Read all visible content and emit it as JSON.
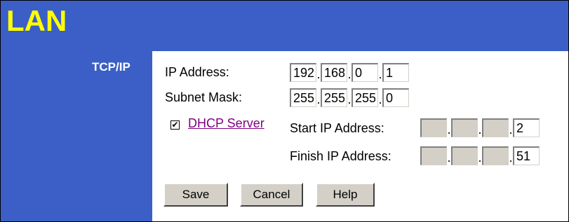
{
  "page": {
    "title": "LAN",
    "section_label": "TCP/IP"
  },
  "ip_address": {
    "label": "IP Address:",
    "octets": [
      "192",
      "168",
      "0",
      "1"
    ]
  },
  "subnet_mask": {
    "label": "Subnet Mask:",
    "octets": [
      "255",
      "255",
      "255",
      "0"
    ]
  },
  "dhcp": {
    "checked": true,
    "checkbox_glyph": "✔",
    "link_label": "DHCP Server",
    "start": {
      "label": "Start IP Address:",
      "octets": [
        "",
        "",
        "",
        "2"
      ]
    },
    "finish": {
      "label": "Finish IP Address:",
      "octets": [
        "",
        "",
        "",
        "51"
      ]
    }
  },
  "buttons": {
    "save": "Save",
    "cancel": "Cancel",
    "help": "Help"
  },
  "colors": {
    "header_bg": "#3b5fc6",
    "title": "#ffff00",
    "link": "#800080",
    "button_bg": "#d4d0c8"
  }
}
